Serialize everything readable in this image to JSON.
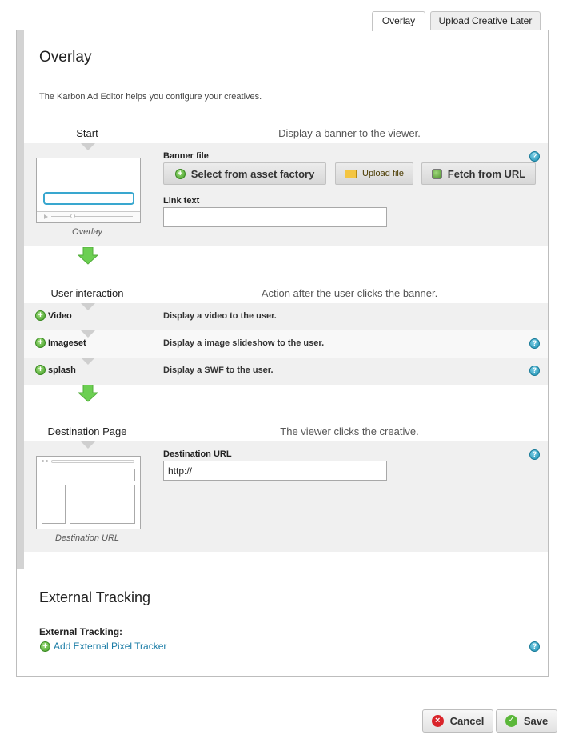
{
  "tabs": [
    {
      "label": "Overlay",
      "active": true
    },
    {
      "label": "Upload Creative Later",
      "active": false
    }
  ],
  "overlay": {
    "title": "Overlay",
    "intro": "The Karbon Ad Editor helps you configure your creatives.",
    "start": {
      "step_title": "Start",
      "step_desc": "Display a banner to the viewer.",
      "thumb_caption": "Overlay",
      "banner_file_label": "Banner file",
      "select_asset_label": "Select from asset factory",
      "upload_file_label": "Upload file",
      "fetch_url_label": "Fetch from URL",
      "link_text_label": "Link text",
      "link_text_value": ""
    },
    "interaction": {
      "step_title": "User interaction",
      "step_desc": "Action after the user clicks the banner.",
      "rows": [
        {
          "label": "Video",
          "desc": "Display a video to the user.",
          "help": false
        },
        {
          "label": "Imageset",
          "desc": "Display a image slideshow to the user.",
          "help": true
        },
        {
          "label": "splash",
          "desc": "Display a SWF to the user.",
          "help": true
        }
      ]
    },
    "destination": {
      "step_title": "Destination Page",
      "step_desc": "The viewer clicks the creative.",
      "thumb_caption": "Destination URL",
      "url_label": "Destination URL",
      "url_value": "http://"
    }
  },
  "tracking": {
    "title": "External Tracking",
    "label": "External Tracking:",
    "add_link": "Add External Pixel Tracker"
  },
  "footer": {
    "cancel_label": "Cancel",
    "save_label": "Save"
  },
  "colors": {
    "accent_link": "#1a7ca6",
    "arrow_green": "#6ccf52",
    "help_blue": "#1a8db0"
  }
}
